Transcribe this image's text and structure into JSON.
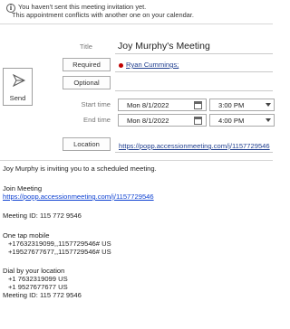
{
  "infobar": {
    "line1": "You haven't sent this meeting invitation yet.",
    "line2": "This appointment conflicts with another one on your calendar.",
    "icon": "info-icon"
  },
  "send": {
    "label": "Send",
    "icon": "send-icon"
  },
  "fields": {
    "title_label": "Title",
    "title_value": "Joy Murphy's Meeting",
    "required_label": "Required",
    "required_attendee": "Ryan Cummings;",
    "optional_label": "Optional",
    "start_label": "Start time",
    "start_date": "Mon 8/1/2022",
    "start_time": "3:00 PM",
    "end_label": "End time",
    "end_date": "Mon 8/1/2022",
    "end_time": "4:00 PM",
    "location_label": "Location",
    "location_value": "https://popp.accessionmeeting.com/j/1157729546"
  },
  "body": {
    "intro": "Joy Murphy is inviting you to a scheduled meeting.",
    "join_heading": "Join Meeting",
    "join_link": "https://popp.accessionmeeting.com/j/1157729546",
    "meeting_id_1": "Meeting ID: 115 772 9546",
    "one_tap_heading": "One tap mobile",
    "one_tap_1": "+17632319099,,1157729546# US",
    "one_tap_2": "+19527677677,,1157729546# US",
    "dial_heading": "Dial by your location",
    "dial_1": "+1 7632319099 US",
    "dial_2": "+1 9527677677 US",
    "meeting_id_2": "Meeting ID: 115 772 9546"
  },
  "colors": {
    "link": "#0b3fd1",
    "attendee_dot": "#c00000"
  }
}
